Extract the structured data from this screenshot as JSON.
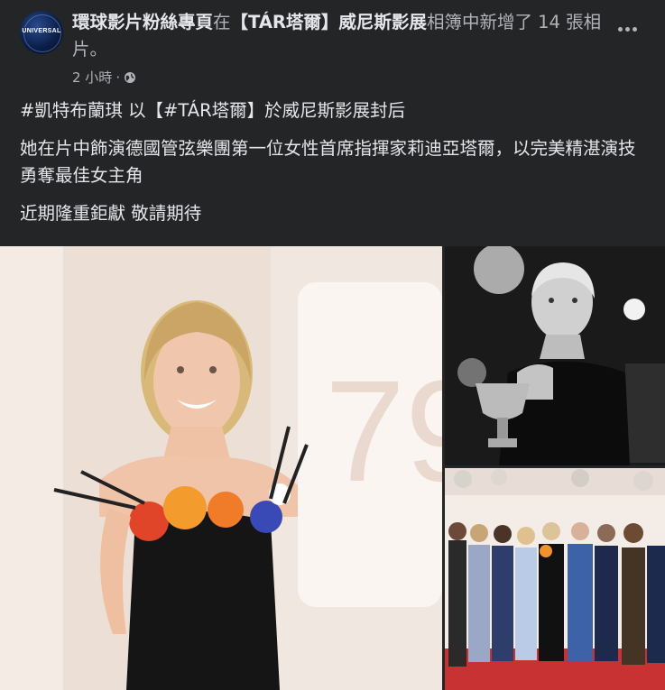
{
  "header": {
    "page_name": "環球影片粉絲專頁",
    "action_text": "在",
    "album_name": "【TÁR塔爾】威尼斯影展",
    "action_suffix": "相簿中新增了 14 張相片。",
    "timestamp": "2 小時",
    "separator": "·",
    "avatar_logo": "UNIVERSAL",
    "privacy_icon": "globe-icon",
    "more_icon": "more-options-icon"
  },
  "post": {
    "line1": "#凱特布蘭琪 以【#TÁR塔爾】於威尼斯影展封后",
    "line2": "她在片中飾演德國管弦樂團第一位女性首席指揮家莉迪亞塔爾，以完美精湛演技勇奪最佳女主角",
    "line3": "近期隆重鉅獻 敬請期待"
  },
  "colors": {
    "background": "#242526",
    "primary_text": "#e4e6eb",
    "secondary_text": "#b0b3b8"
  }
}
